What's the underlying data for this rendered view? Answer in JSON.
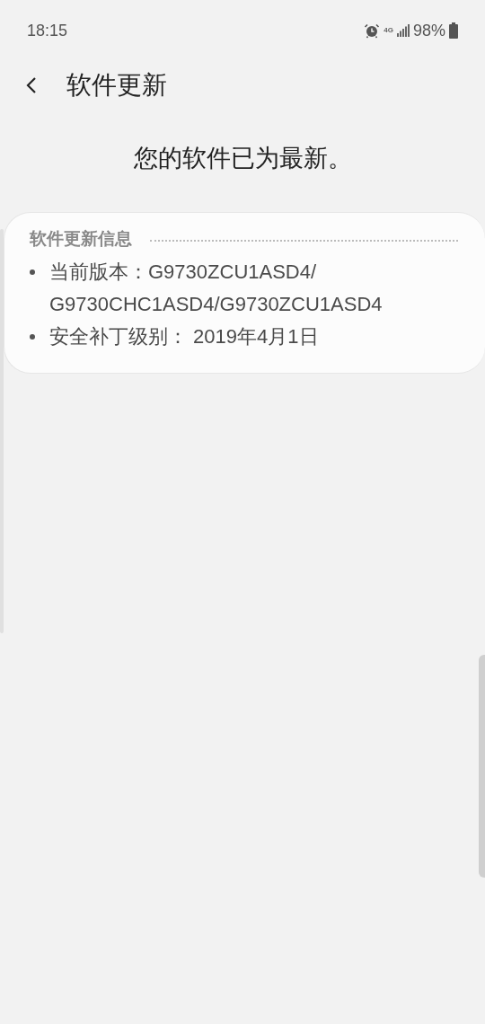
{
  "status_bar": {
    "time": "18:15",
    "network": "4G",
    "battery": "98%"
  },
  "header": {
    "title": "软件更新"
  },
  "message": "您的软件已为最新。",
  "info_card": {
    "title": "软件更新信息",
    "items": [
      "当前版本：G9730ZCU1ASD4/G9730CHC1ASD4/G9730ZCU1ASD4",
      "安全补丁级别： 2019年4月1日"
    ]
  }
}
